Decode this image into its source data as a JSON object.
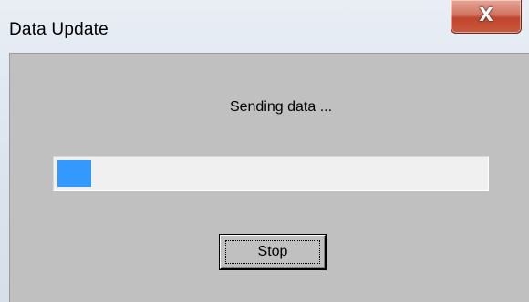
{
  "window": {
    "title": "Data Update",
    "close_icon_glyph": "X"
  },
  "dialog": {
    "status_message": "Sending data ...",
    "progress_fraction": 0.08,
    "stop_button": {
      "accelerator": "S",
      "label_rest": "top"
    }
  },
  "colors": {
    "progress_fill": "#3399ff",
    "client_background": "#c0c0c0",
    "close_button": "#c8553c"
  },
  "icons": {
    "close": "close-icon"
  }
}
